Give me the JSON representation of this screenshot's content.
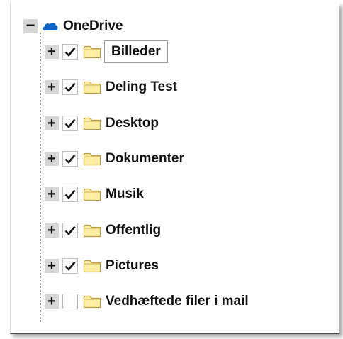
{
  "tree": {
    "root": {
      "label": "OneDrive",
      "toggle": "−",
      "icon": "onedrive-cloud-icon",
      "icon_color": "#0a64c8"
    },
    "children": [
      {
        "label": "Billeder",
        "toggle": "+",
        "checked": true,
        "focused": true
      },
      {
        "label": "Deling Test",
        "toggle": "+",
        "checked": true,
        "focused": false
      },
      {
        "label": "Desktop",
        "toggle": "+",
        "checked": true,
        "focused": false
      },
      {
        "label": "Dokumenter",
        "toggle": "+",
        "checked": true,
        "focused": false
      },
      {
        "label": "Musik",
        "toggle": "+",
        "checked": true,
        "focused": false
      },
      {
        "label": "Offentlig",
        "toggle": "+",
        "checked": true,
        "focused": false
      },
      {
        "label": "Pictures",
        "toggle": "+",
        "checked": true,
        "focused": false
      },
      {
        "label": "Vedhæftede filer i mail",
        "toggle": "+",
        "checked": false,
        "focused": false
      }
    ]
  },
  "colors": {
    "folder_fill": "#fdeea3",
    "folder_stroke": "#b89a3a",
    "check": "#111111",
    "toggle_bg": "#d6d6d6"
  }
}
